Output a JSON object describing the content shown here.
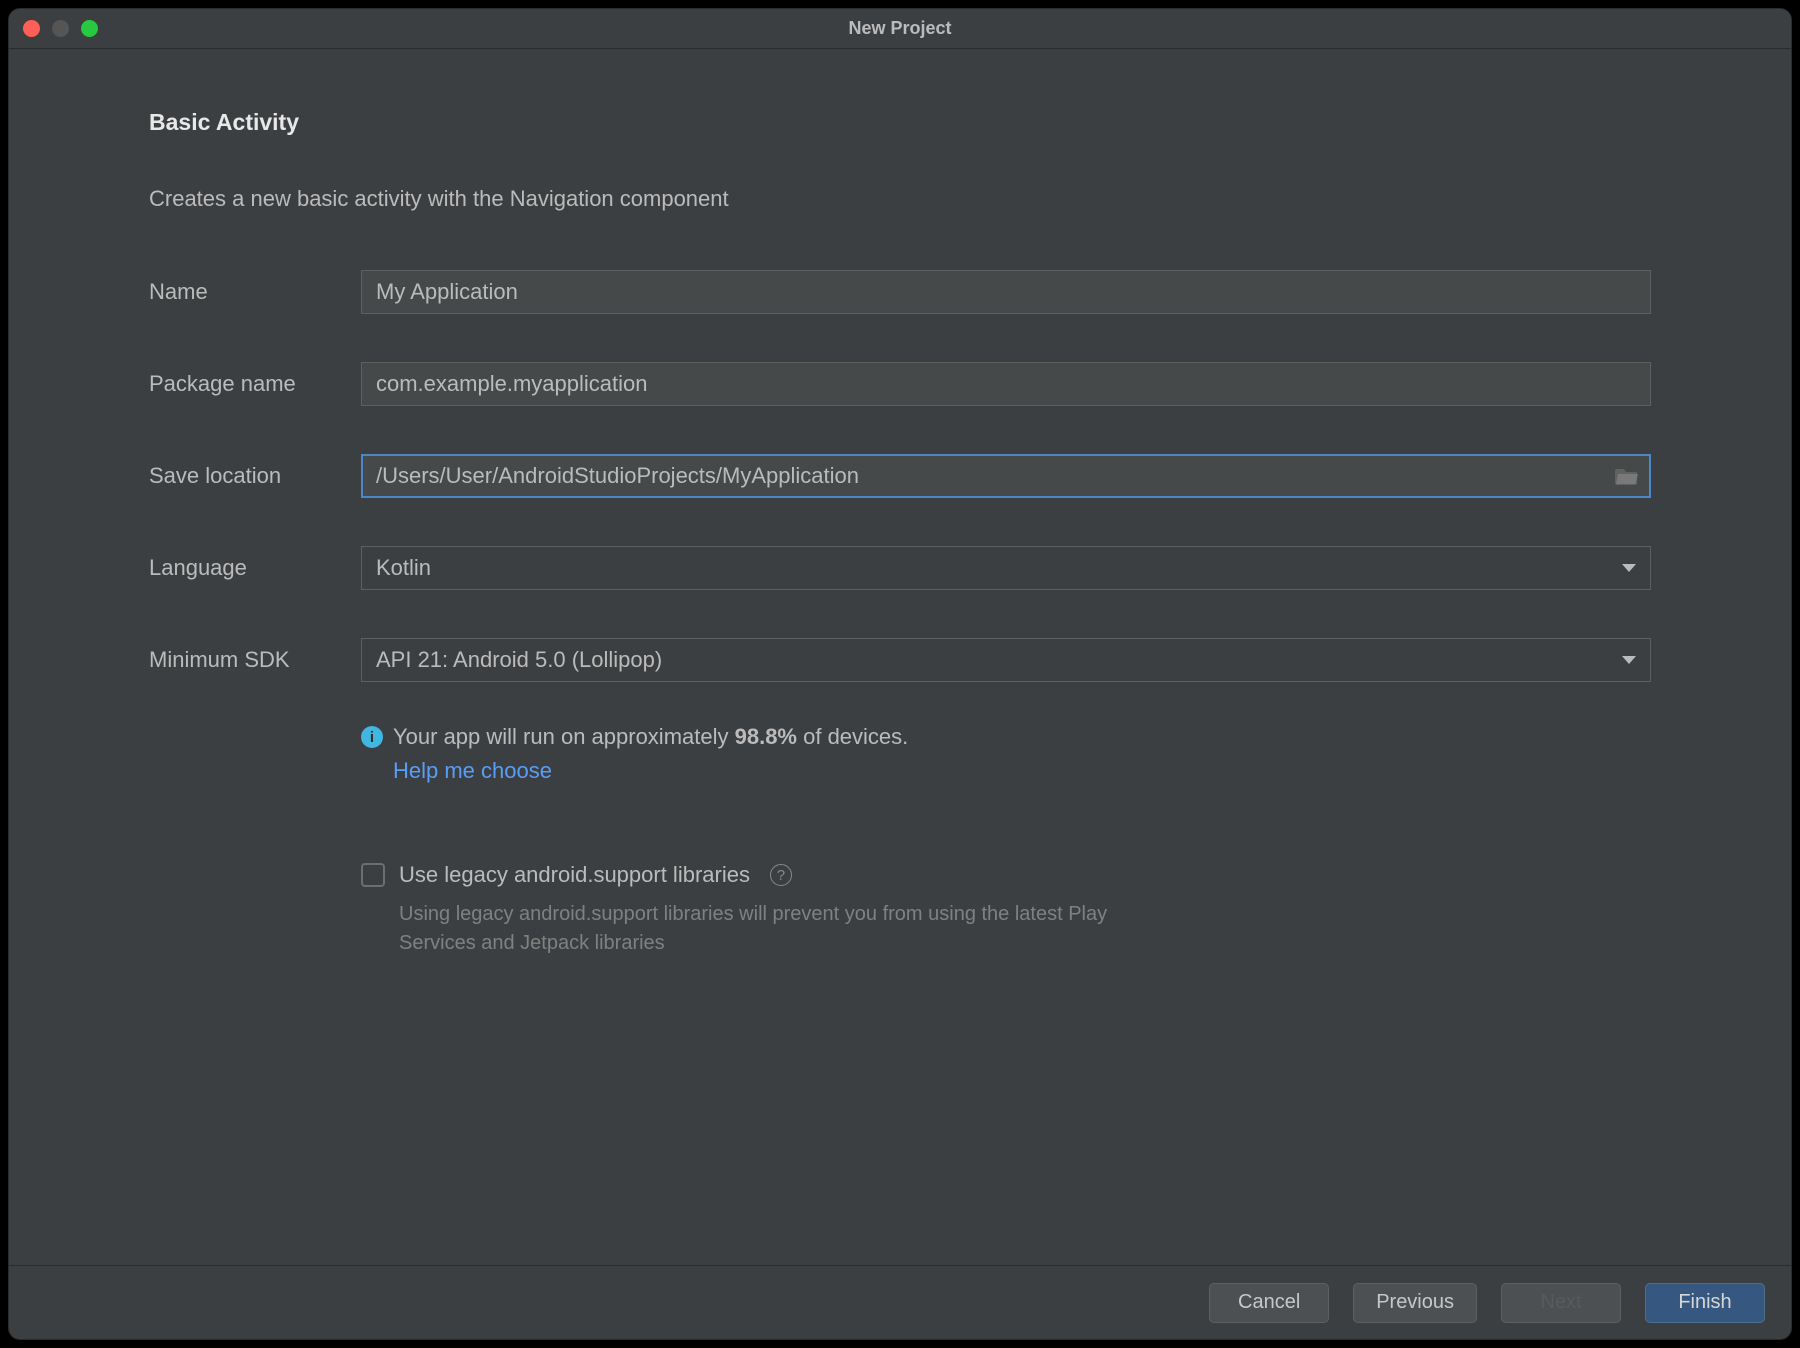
{
  "window": {
    "title": "New Project"
  },
  "page": {
    "heading": "Basic Activity",
    "subtitle": "Creates a new basic activity with the Navigation component"
  },
  "form": {
    "name": {
      "label": "Name",
      "value": "My Application"
    },
    "package": {
      "label": "Package name",
      "value": "com.example.myapplication"
    },
    "location": {
      "label": "Save location",
      "value": "/Users/User/AndroidStudioProjects/MyApplication"
    },
    "language": {
      "label": "Language",
      "value": "Kotlin"
    },
    "minsdk": {
      "label": "Minimum SDK",
      "value": "API 21: Android 5.0 (Lollipop)"
    }
  },
  "info": {
    "prefix": "Your app will run on approximately ",
    "pct": "98.8%",
    "suffix": " of devices.",
    "link": "Help me choose"
  },
  "legacy": {
    "label": "Use legacy android.support libraries",
    "hint": "Using legacy android.support libraries will prevent you from using the latest Play Services and Jetpack libraries"
  },
  "buttons": {
    "cancel": "Cancel",
    "previous": "Previous",
    "next": "Next",
    "finish": "Finish"
  }
}
